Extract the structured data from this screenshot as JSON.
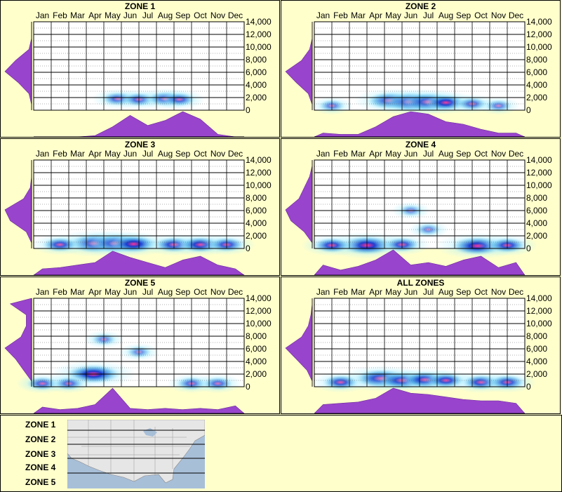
{
  "months": [
    "Jan",
    "Feb",
    "Mar",
    "Apr",
    "May",
    "Jun",
    "Jul",
    "Aug",
    "Sep",
    "Oct",
    "Nov",
    "Dec"
  ],
  "yticks": [
    "14,000",
    "12,000",
    "10,000",
    "8,000",
    "6,000",
    "4,000",
    "2,000",
    "0"
  ],
  "colors": {
    "background": "#ffffcc",
    "profile": "#9944cc",
    "heat_low": "#aaeeff",
    "heat_mid": "#1133cc",
    "heat_high": "#ff3399"
  },
  "chart_data": [
    {
      "type": "heatmap",
      "title": "ZONE 1",
      "ylim": [
        0,
        14000
      ],
      "hot": [
        {
          "month": 5.3,
          "elev": 1800,
          "i": 0.35
        },
        {
          "month": 6.5,
          "elev": 1700,
          "i": 0.35
        },
        {
          "month": 8.0,
          "elev": 1800,
          "i": 0.45
        },
        {
          "month": 8.8,
          "elev": 1700,
          "i": 0.35
        }
      ],
      "month_profile": [
        0,
        0,
        0,
        0.05,
        0.4,
        0.85,
        0.45,
        0.65,
        1.0,
        0.7,
        0.1,
        0
      ],
      "elev_profile": [
        0,
        0.1,
        0.5,
        1.0,
        0.6,
        0.1,
        0,
        0
      ]
    },
    {
      "type": "heatmap",
      "title": "ZONE 2",
      "ylim": [
        0,
        14000
      ],
      "hot": [
        {
          "month": 4.8,
          "elev": 1500,
          "i": 0.7
        },
        {
          "month": 6.0,
          "elev": 1300,
          "i": 0.95
        },
        {
          "month": 7.0,
          "elev": 1300,
          "i": 0.85
        },
        {
          "month": 8.0,
          "elev": 1200,
          "i": 0.6
        },
        {
          "month": 9.5,
          "elev": 1000,
          "i": 0.3
        },
        {
          "month": 1.5,
          "elev": 700,
          "i": 0.2
        },
        {
          "month": 11,
          "elev": 700,
          "i": 0.2
        }
      ],
      "month_profile": [
        0.15,
        0.1,
        0.1,
        0.4,
        0.8,
        1.0,
        0.9,
        0.6,
        0.5,
        0.3,
        0.15,
        0.15
      ],
      "elev_profile": [
        0,
        0.15,
        0.6,
        1.0,
        0.4,
        0.1,
        0,
        0
      ]
    },
    {
      "type": "heatmap",
      "title": "ZONE 3",
      "ylim": [
        0,
        14000
      ],
      "hot": [
        {
          "month": 4.0,
          "elev": 800,
          "i": 0.95
        },
        {
          "month": 5.2,
          "elev": 800,
          "i": 0.9
        },
        {
          "month": 6.2,
          "elev": 700,
          "i": 0.75
        },
        {
          "month": 2.0,
          "elev": 600,
          "i": 0.45
        },
        {
          "month": 8.5,
          "elev": 600,
          "i": 0.55
        },
        {
          "month": 10.0,
          "elev": 600,
          "i": 0.6
        },
        {
          "month": 11.5,
          "elev": 600,
          "i": 0.45
        }
      ],
      "month_profile": [
        0.25,
        0.3,
        0.4,
        0.5,
        0.95,
        0.7,
        0.5,
        0.3,
        0.6,
        0.75,
        0.4,
        0.25
      ],
      "elev_profile": [
        0,
        0.2,
        0.8,
        1.0,
        0.3,
        0.05,
        0,
        0
      ]
    },
    {
      "type": "heatmap",
      "title": "ZONE 4",
      "ylim": [
        0,
        14000
      ],
      "hot": [
        {
          "month": 3.5,
          "elev": 500,
          "i": 0.95
        },
        {
          "month": 1.5,
          "elev": 500,
          "i": 0.5
        },
        {
          "month": 5.5,
          "elev": 600,
          "i": 0.45
        },
        {
          "month": 9.8,
          "elev": 400,
          "i": 0.9
        },
        {
          "month": 11.5,
          "elev": 500,
          "i": 0.5
        },
        {
          "month": 6.0,
          "elev": 6000,
          "i": 0.12
        },
        {
          "month": 7.0,
          "elev": 3000,
          "i": 0.15
        }
      ],
      "month_profile": [
        0.4,
        0.2,
        0.35,
        0.6,
        1.0,
        0.4,
        0.5,
        0.35,
        0.6,
        0.75,
        0.3,
        0.5
      ],
      "elev_profile": [
        0,
        0.3,
        0.8,
        1.0,
        0.5,
        0.3,
        0.1,
        0
      ]
    },
    {
      "type": "heatmap",
      "title": "ZONE 5",
      "ylim": [
        0,
        14000
      ],
      "hot": [
        {
          "month": 3.9,
          "elev": 2000,
          "i": 0.95
        },
        {
          "month": 1.0,
          "elev": 500,
          "i": 0.35
        },
        {
          "month": 2.5,
          "elev": 500,
          "i": 0.3
        },
        {
          "month": 4.5,
          "elev": 7500,
          "i": 0.15
        },
        {
          "month": 6.5,
          "elev": 5500,
          "i": 0.15
        },
        {
          "month": 9.5,
          "elev": 500,
          "i": 0.3
        },
        {
          "month": 11,
          "elev": 500,
          "i": 0.3
        }
      ],
      "month_profile": [
        0.25,
        0.15,
        0.2,
        0.35,
        1.0,
        0.2,
        0.15,
        0.2,
        0.15,
        0.2,
        0.15,
        0.3
      ],
      "elev_profile": [
        0,
        0.3,
        0.6,
        1.0,
        0.4,
        0.2,
        0.2,
        0.8
      ]
    },
    {
      "type": "heatmap",
      "title": "ALL ZONES",
      "ylim": [
        0,
        14000
      ],
      "hot": [
        {
          "month": 4.3,
          "elev": 1300,
          "i": 0.9
        },
        {
          "month": 5.5,
          "elev": 1000,
          "i": 0.7
        },
        {
          "month": 6.8,
          "elev": 1100,
          "i": 0.65
        },
        {
          "month": 8.0,
          "elev": 1000,
          "i": 0.5
        },
        {
          "month": 2.0,
          "elev": 700,
          "i": 0.45
        },
        {
          "month": 10.0,
          "elev": 700,
          "i": 0.5
        },
        {
          "month": 11.5,
          "elev": 700,
          "i": 0.45
        }
      ],
      "month_profile": [
        0.35,
        0.4,
        0.45,
        0.6,
        1.0,
        0.8,
        0.75,
        0.65,
        0.55,
        0.5,
        0.5,
        0.4
      ],
      "elev_profile": [
        0,
        0.2,
        0.6,
        1.0,
        0.4,
        0.15,
        0.05,
        0
      ]
    }
  ],
  "legend": {
    "zones": [
      "ZONE 1",
      "ZONE 2",
      "ZONE 3",
      "ZONE 4",
      "ZONE 5"
    ]
  }
}
